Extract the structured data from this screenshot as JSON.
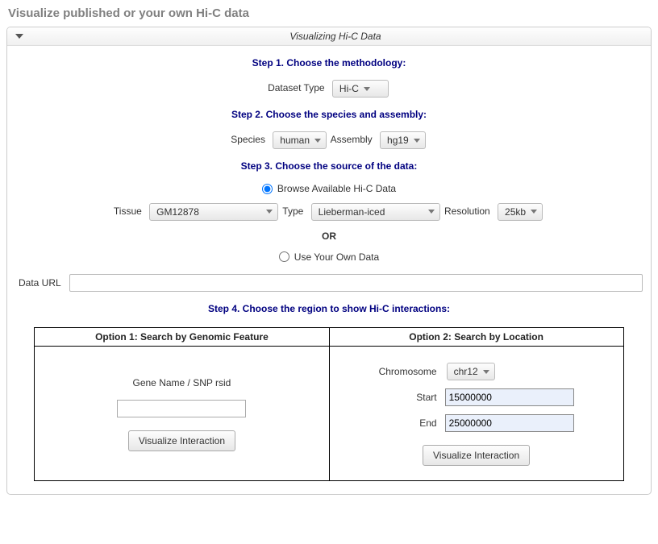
{
  "header": {
    "page_title": "Visualize published or your own Hi-C data",
    "panel_title": "Visualizing Hi-C Data"
  },
  "steps": {
    "s1": "Step 1. Choose the methodology:",
    "s2": "Step 2. Choose the species and assembly:",
    "s3": "Step 3. Choose the source of the data:",
    "s4": "Step 4. Choose the region to show Hi-C interactions:"
  },
  "labels": {
    "dataset_type": "Dataset Type",
    "species": "Species",
    "assembly": "Assembly",
    "browse_radio": "Browse Available Hi-C Data",
    "tissue": "Tissue",
    "type": "Type",
    "resolution": "Resolution",
    "or": "OR",
    "use_own_radio": "Use Your Own Data",
    "data_url": "Data URL",
    "option1_header": "Option 1: Search by Genomic Feature",
    "option2_header": "Option 2: Search by Location",
    "gene_label": "Gene Name / SNP rsid",
    "chromosome": "Chromosome",
    "start": "Start",
    "end": "End",
    "visualize_button": "Visualize Interaction"
  },
  "values": {
    "dataset_type": "Hi-C",
    "species": "human",
    "assembly": "hg19",
    "tissue": "GM12878",
    "type": "Lieberman-iced",
    "resolution": "25kb",
    "data_url": "",
    "gene": "",
    "chromosome": "chr12",
    "start": "15000000",
    "end": "25000000"
  },
  "radio": {
    "browse_checked": true,
    "own_checked": false
  }
}
